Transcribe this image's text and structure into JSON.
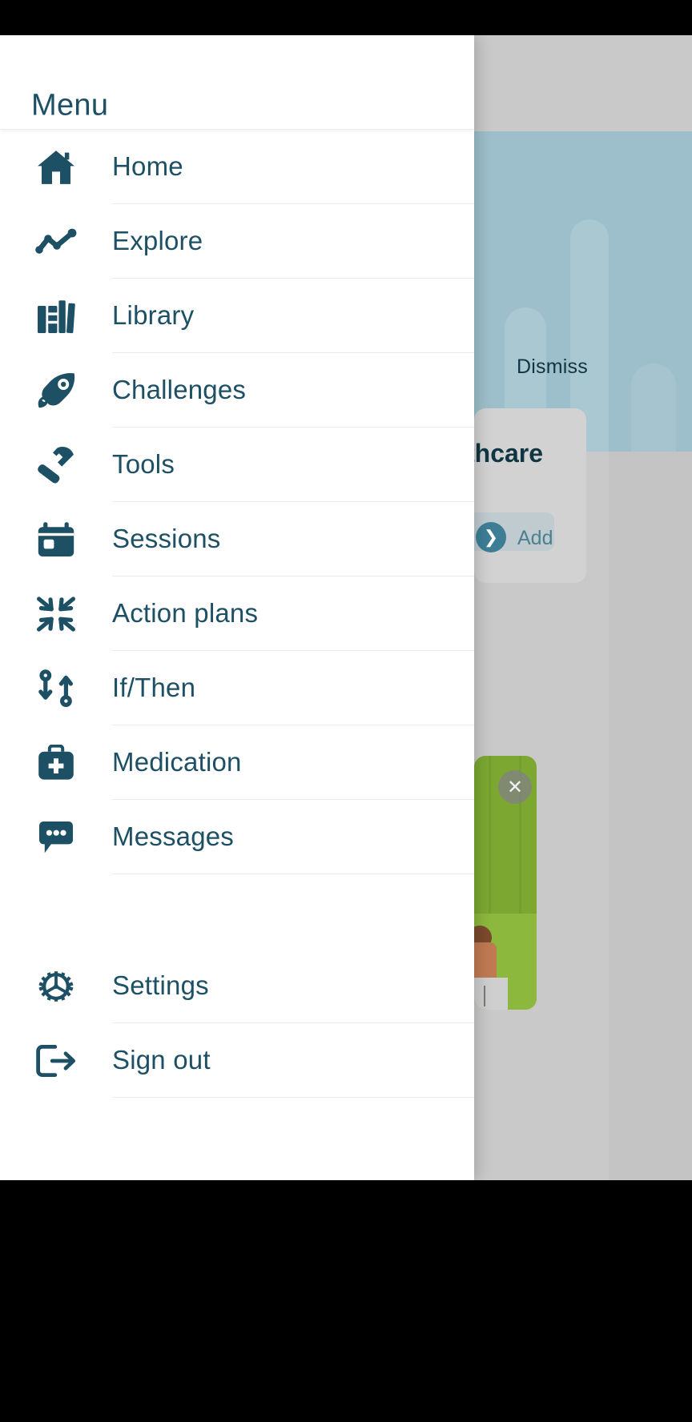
{
  "theme": {
    "accent": "#1d5065",
    "drawer_bg": "#ffffff",
    "divider": "#eaeaea",
    "backdrop": "#c9c9c9",
    "hero": "#9dbfcb",
    "image_card_green": "#7ca832",
    "chevron_circle": "#3d7e96"
  },
  "drawer": {
    "title": "Menu",
    "items": [
      {
        "label": "Home",
        "icon": "home-icon"
      },
      {
        "label": "Explore",
        "icon": "chart-line-icon"
      },
      {
        "label": "Library",
        "icon": "books-icon"
      },
      {
        "label": "Challenges",
        "icon": "rocket-icon"
      },
      {
        "label": "Tools",
        "icon": "hammer-icon"
      },
      {
        "label": "Sessions",
        "icon": "calendar-icon"
      },
      {
        "label": "Action plans",
        "icon": "compress-arrows-icon"
      },
      {
        "label": "If/Then",
        "icon": "exchange-arrows-icon"
      },
      {
        "label": "Medication",
        "icon": "medical-bag-icon"
      },
      {
        "label": "Messages",
        "icon": "chat-bubble-dots-icon"
      }
    ],
    "footer_items": [
      {
        "label": "Settings",
        "icon": "gear-icon"
      },
      {
        "label": "Sign out",
        "icon": "sign-out-icon"
      }
    ]
  },
  "background": {
    "dismiss_label": "Dismiss",
    "card_title_partial": "thcare",
    "add_label": "Add",
    "chevron_glyph": "❯",
    "close_glyph": "✕"
  }
}
